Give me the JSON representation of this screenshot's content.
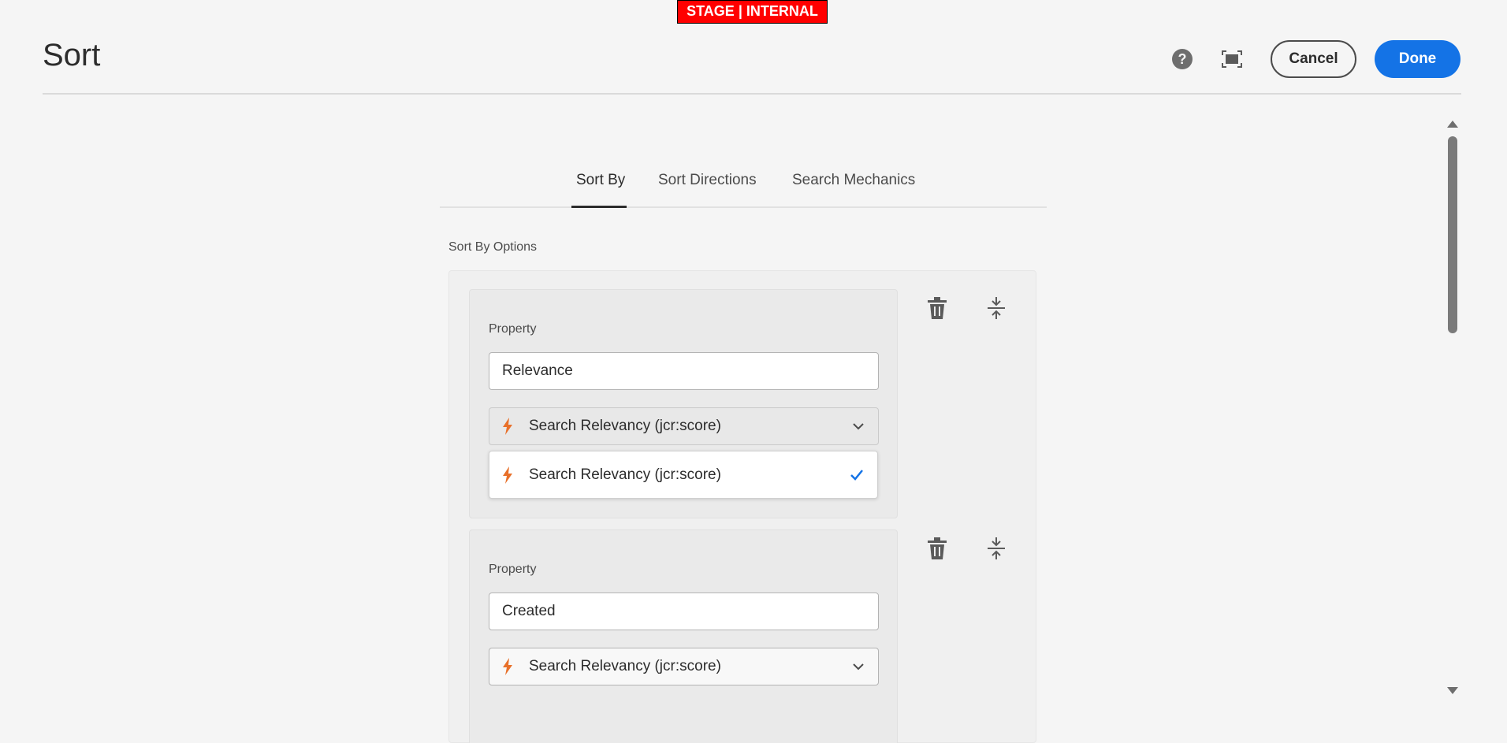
{
  "environment_badge": "STAGE | INTERNAL",
  "header": {
    "title": "Sort",
    "help_icon": "help-icon",
    "fullscreen_icon": "fullscreen-icon",
    "cancel_label": "Cancel",
    "done_label": "Done",
    "accent_color": "#1473e6"
  },
  "tabs": [
    {
      "label": "Sort By",
      "active": true
    },
    {
      "label": "Sort Directions",
      "active": false
    },
    {
      "label": "Search Mechanics",
      "active": false
    }
  ],
  "section": {
    "label": "Sort By Options"
  },
  "items": [
    {
      "property_label": "Property",
      "property_value": "Relevance",
      "select_value": "Search Relevancy (jcr:score)",
      "dropdown_open": true,
      "dropdown_options": [
        {
          "label": "Search Relevancy (jcr:score)",
          "selected": true
        }
      ],
      "delete_icon": "trash-icon",
      "reorder_icon": "drag-handle-icon"
    },
    {
      "property_label": "Property",
      "property_value": "Created",
      "select_value": "Search Relevancy (jcr:score)",
      "dropdown_open": false,
      "delete_icon": "trash-icon",
      "reorder_icon": "drag-handle-icon"
    }
  ],
  "colors": {
    "badge_bg": "#ff0000",
    "bolt": "#e8702a",
    "check": "#1473e6"
  }
}
